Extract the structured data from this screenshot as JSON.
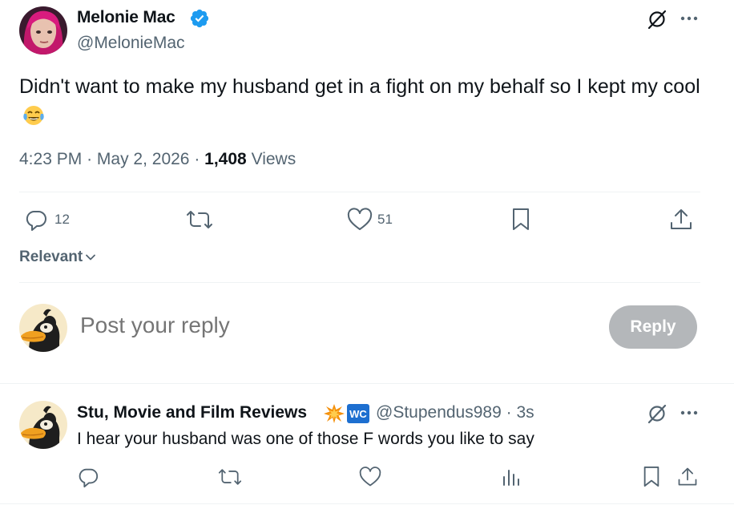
{
  "tweet": {
    "author_name": "Melonie Mac",
    "author_handle": "@MelonieMac",
    "text": "Didn't want to make my husband get in a fight on my behalf so I kept my cool",
    "time": "4:23 PM",
    "date": "May 2, 2026",
    "views_count": "1,408",
    "views_label": "Views",
    "replies": "12",
    "likes": "51"
  },
  "sort": {
    "label": "Relevant"
  },
  "composer": {
    "placeholder": "Post your reply",
    "button_label": "Reply"
  },
  "reply": {
    "author_name": "Stu, Movie and Film Reviews",
    "badge_text": "WC",
    "author_handle": "@Stupendus989",
    "age": "3s",
    "text": "I hear your husband was one of those F words you like to say"
  },
  "colors": {
    "accent": "#1d9bf0",
    "muted": "#536471",
    "text": "#0f1419",
    "reply_button_disabled": "#b4b7ba"
  },
  "icons": [
    "verified-icon",
    "grok-icon",
    "more-icon",
    "reply-icon",
    "repost-icon",
    "like-icon",
    "bookmark-icon",
    "share-icon",
    "views-icon",
    "chevron-down-icon"
  ]
}
